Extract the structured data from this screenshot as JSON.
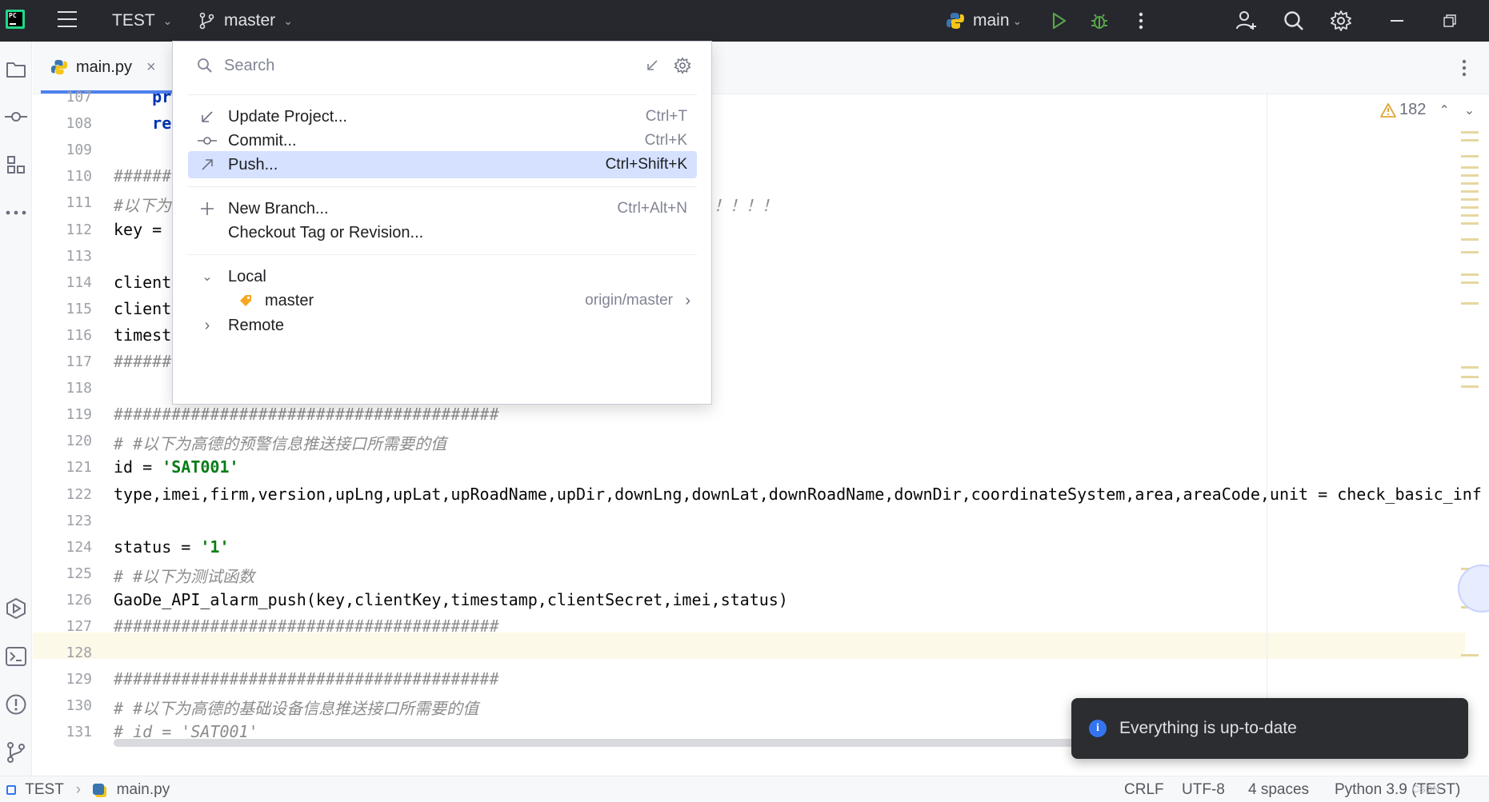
{
  "titlebar": {
    "project": "TEST",
    "branch": "master",
    "run_config": "main"
  },
  "editor_tab": {
    "filename": "main.py"
  },
  "editor": {
    "warnings_count": "182",
    "lines": [
      {
        "num": "107",
        "code": "    pr"
      },
      {
        "num": "108",
        "code": "    re"
      },
      {
        "num": "109",
        "code": ""
      },
      {
        "num": "110",
        "code": "######"
      },
      {
        "num": "111",
        "code": "#以下为"
      },
      {
        "num": "112",
        "code": "key = "
      },
      {
        "num": "113",
        "code": ""
      },
      {
        "num": "114",
        "code": "client"
      },
      {
        "num": "115",
        "code": "client"
      },
      {
        "num": "116",
        "code": "timest"
      },
      {
        "num": "117",
        "code": "######"
      },
      {
        "num": "118",
        "code": ""
      },
      {
        "num": "119",
        "code": "########################################"
      },
      {
        "num": "120",
        "code": "# #以下为高德的预警信息推送接口所需要的值"
      },
      {
        "num": "121",
        "code": "id = 'SAT001'"
      },
      {
        "num": "122",
        "code": "type,imei,firm,version,upLng,upLat,upRoadName,upDir,downLng,downLat,downRoadName,downDir,coordinateSystem,area,areaCode,unit = check_basic_inf"
      },
      {
        "num": "123",
        "code": ""
      },
      {
        "num": "124",
        "code": "status = '1'"
      },
      {
        "num": "125",
        "code": "# #以下为测试函数"
      },
      {
        "num": "126",
        "code": "GaoDe_API_alarm_push(key,clientKey,timestamp,clientSecret,imei,status)"
      },
      {
        "num": "127",
        "code": "########################################"
      },
      {
        "num": "128",
        "code": ""
      },
      {
        "num": "129",
        "code": "########################################"
      },
      {
        "num": "130",
        "code": "# #以下为高德的基础设备信息推送接口所需要的值"
      },
      {
        "num": "131",
        "code": "# id = 'SAT001'"
      }
    ],
    "line111_tail": "！！！！"
  },
  "git_popup": {
    "search_placeholder": "Search",
    "items": [
      {
        "label": "Update Project...",
        "shortcut": "Ctrl+T"
      },
      {
        "label": "Commit...",
        "shortcut": "Ctrl+K"
      },
      {
        "label": "Push...",
        "shortcut": "Ctrl+Shift+K"
      },
      {
        "label": "New Branch...",
        "shortcut": "Ctrl+Alt+N"
      },
      {
        "label": "Checkout Tag or Revision...",
        "shortcut": ""
      }
    ],
    "local_label": "Local",
    "local_branch": "master",
    "local_branch_tracking": "origin/master",
    "remote_label": "Remote"
  },
  "toast": {
    "message": "Everything is up-to-date"
  },
  "statusbar": {
    "project": "TEST",
    "file": "main.py",
    "line_sep": "CRLF",
    "encoding": "UTF-8",
    "indent": "4 spaces",
    "interpreter": "Python 3.9 (TEST)"
  },
  "colors": {
    "titlebar_bg": "#27282e",
    "selection": "#d5e1ff",
    "accent": "#3574f0",
    "comment": "#8c8c8c",
    "string": "#067d17"
  }
}
